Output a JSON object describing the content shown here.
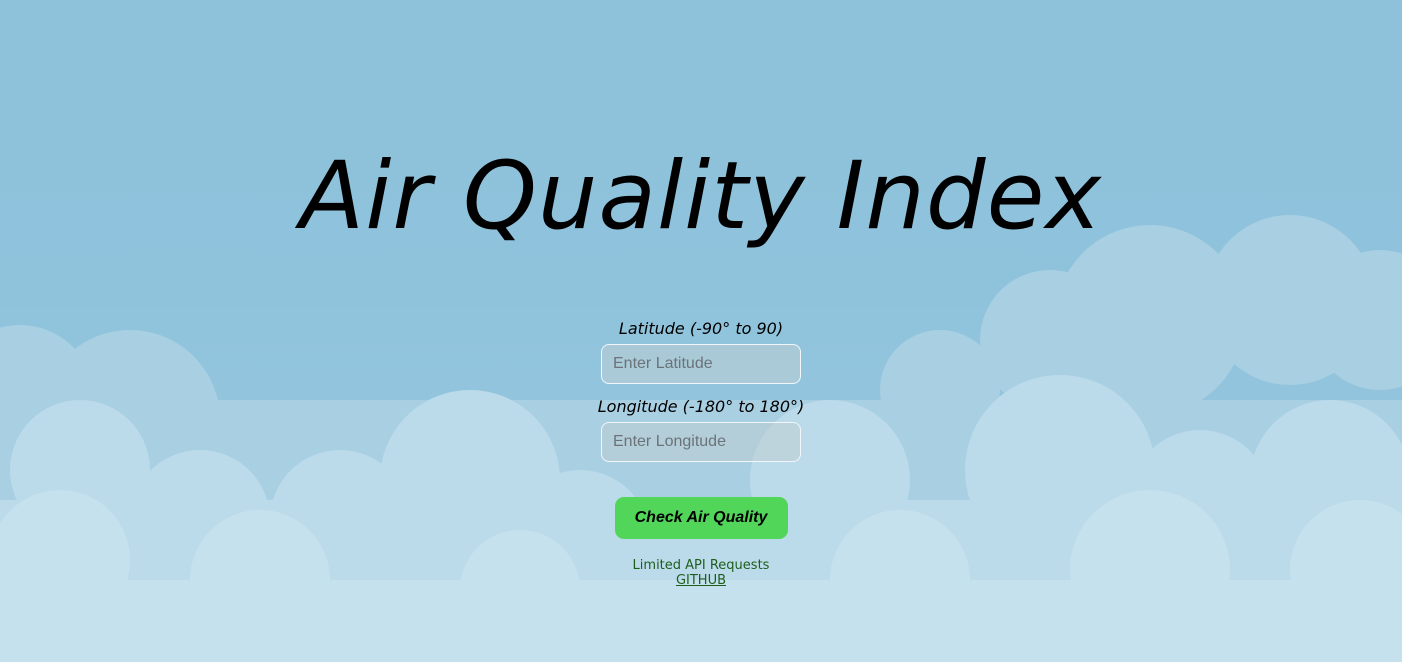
{
  "page": {
    "title": "Air Quality Index"
  },
  "form": {
    "latitude": {
      "label": "Latitude (-90° to 90)",
      "placeholder": "Enter Latitude",
      "value": ""
    },
    "longitude": {
      "label": "Longitude (-180° to 180°)",
      "placeholder": "Enter Longitude",
      "value": ""
    },
    "submit_label": "Check Air Quality"
  },
  "footer": {
    "note": "Limited API Requests",
    "link_label": "GITHUB"
  },
  "colors": {
    "sky": "#8fc3dc",
    "cloud_back": "#a9cfe3",
    "cloud_front": "#c6e1ee",
    "button": "#52d65a",
    "footer_text": "#1d5e1d"
  },
  "icons": [
    "cloud-background"
  ]
}
